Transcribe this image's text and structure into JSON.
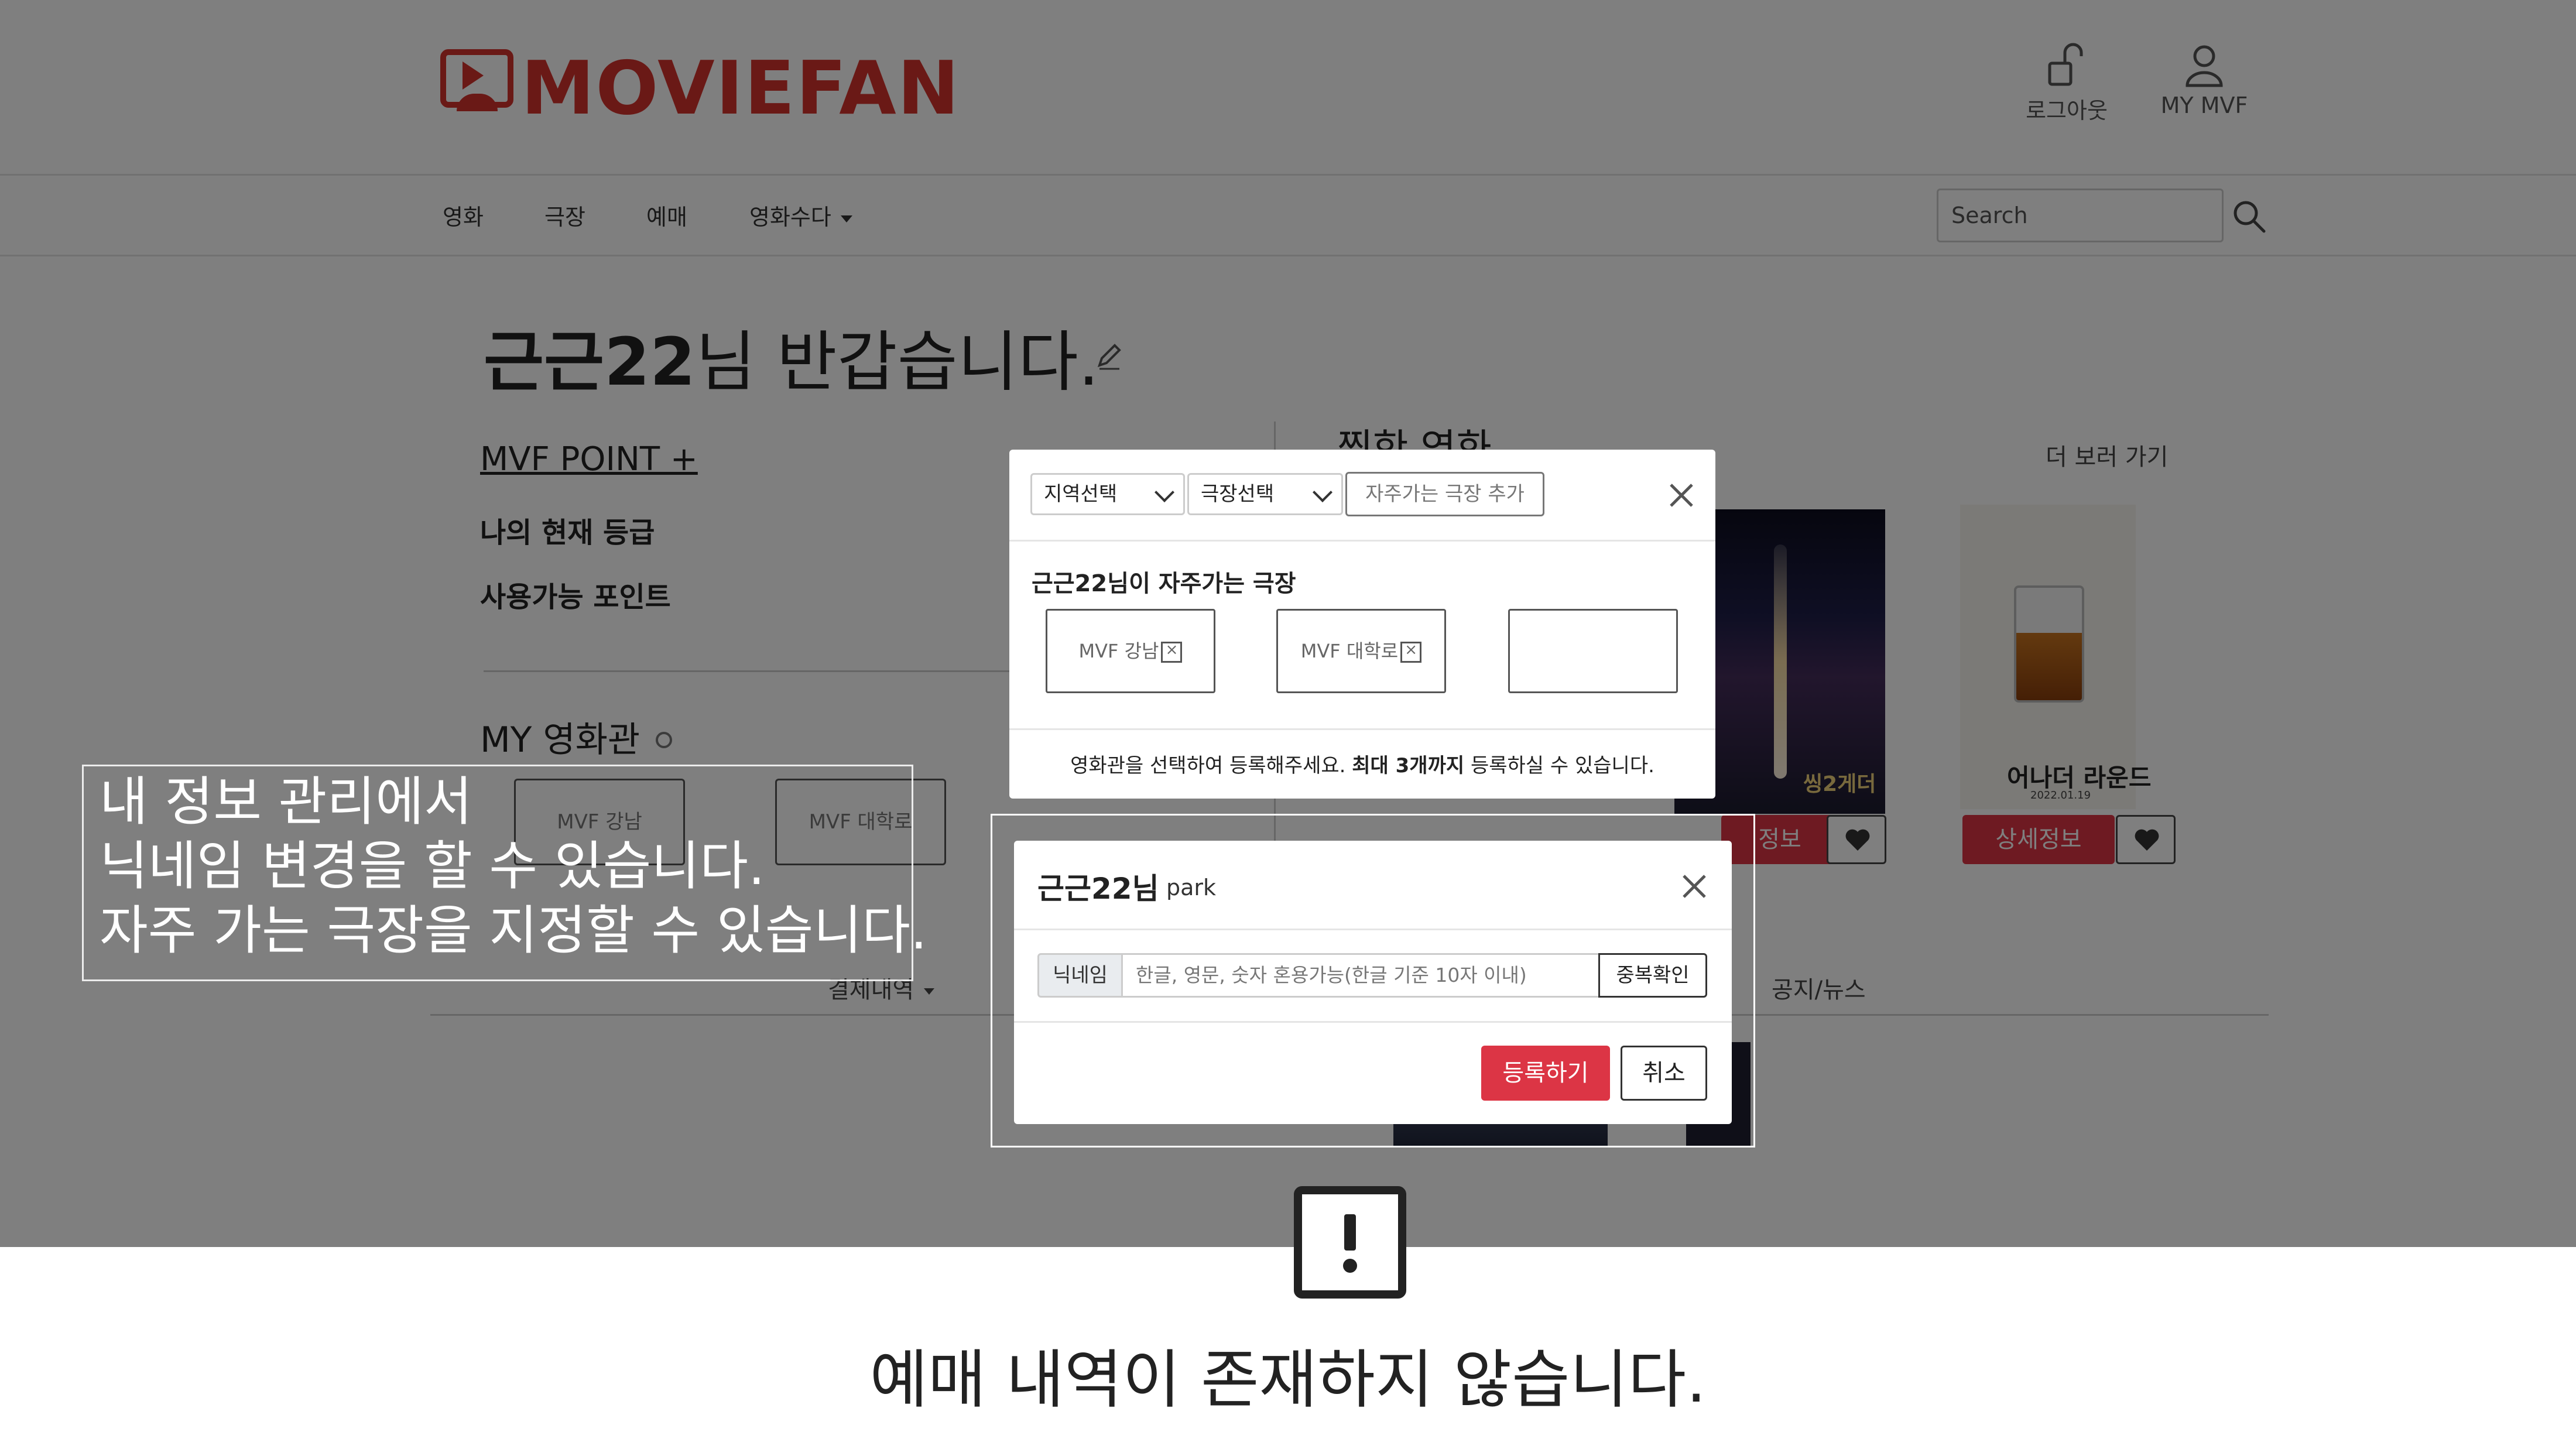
{
  "brand": {
    "name": "MOVIEFAN",
    "color": "#d5322c"
  },
  "header": {
    "logout_label": "로그아웃",
    "my_label": "MY MVF"
  },
  "nav": {
    "items": [
      "영화",
      "극장",
      "예매",
      "영화수다"
    ],
    "search_placeholder": "Search"
  },
  "greeting": {
    "name": "근근22",
    "suffix": "님   반갑습니다."
  },
  "mypage": {
    "point_link": "MVF POINT +",
    "grade_label": "나의 현재 등급",
    "usable_label": "사용가능 포인트",
    "my_cinema_label": "MY 영화관",
    "cinemas": [
      "MVF 강남",
      "MVF 대학로"
    ]
  },
  "favorites": {
    "title": "찜한 영화",
    "more_link": "더 보러 가기",
    "posters": [
      {
        "title": "씽2게더",
        "detail_label": "정보"
      },
      {
        "title": "어나더 라운드",
        "date": "2022.01.19",
        "detail_label": "상세정보"
      }
    ]
  },
  "sub_tabs": {
    "payment": "결제내역",
    "notice": "공지/뉴스"
  },
  "theater_modal": {
    "region_select": "지역선택",
    "theater_select": "극장선택",
    "add_button": "자주가는 극장 추가",
    "section_title": "근근22님이 자주가는 극장",
    "favorites": [
      "MVF 강남",
      "MVF 대학로",
      ""
    ],
    "notice_pre": "영화관을 선택하여 등록해주세요. ",
    "notice_bold": "최대 3개까지",
    "notice_post": " 등록하실 수 있습니다."
  },
  "nickname_modal": {
    "title": "근근22님",
    "subtitle": "park",
    "label": "닉네임",
    "placeholder": "한글, 영문, 숫자 혼용가능(한글 기준 10자 이내)",
    "check_button": "중복확인",
    "register_button": "등록하기",
    "cancel_button": "취소"
  },
  "caption": {
    "lines": [
      "내 정보 관리에서",
      "닉네임 변경을 할 수 있습니다.",
      "자주 가는 극장을 지정할 수 있습니다."
    ]
  },
  "empty_notice": "예매 내역이 존재하지 않습니다.",
  "colors": {
    "accent": "#dc3545",
    "overlay": "rgba(0,0,0,0.5)"
  },
  "icons": [
    "logout-icon",
    "user-icon",
    "search-icon",
    "pencil-icon",
    "close-icon",
    "heart-icon",
    "warning-icon"
  ]
}
